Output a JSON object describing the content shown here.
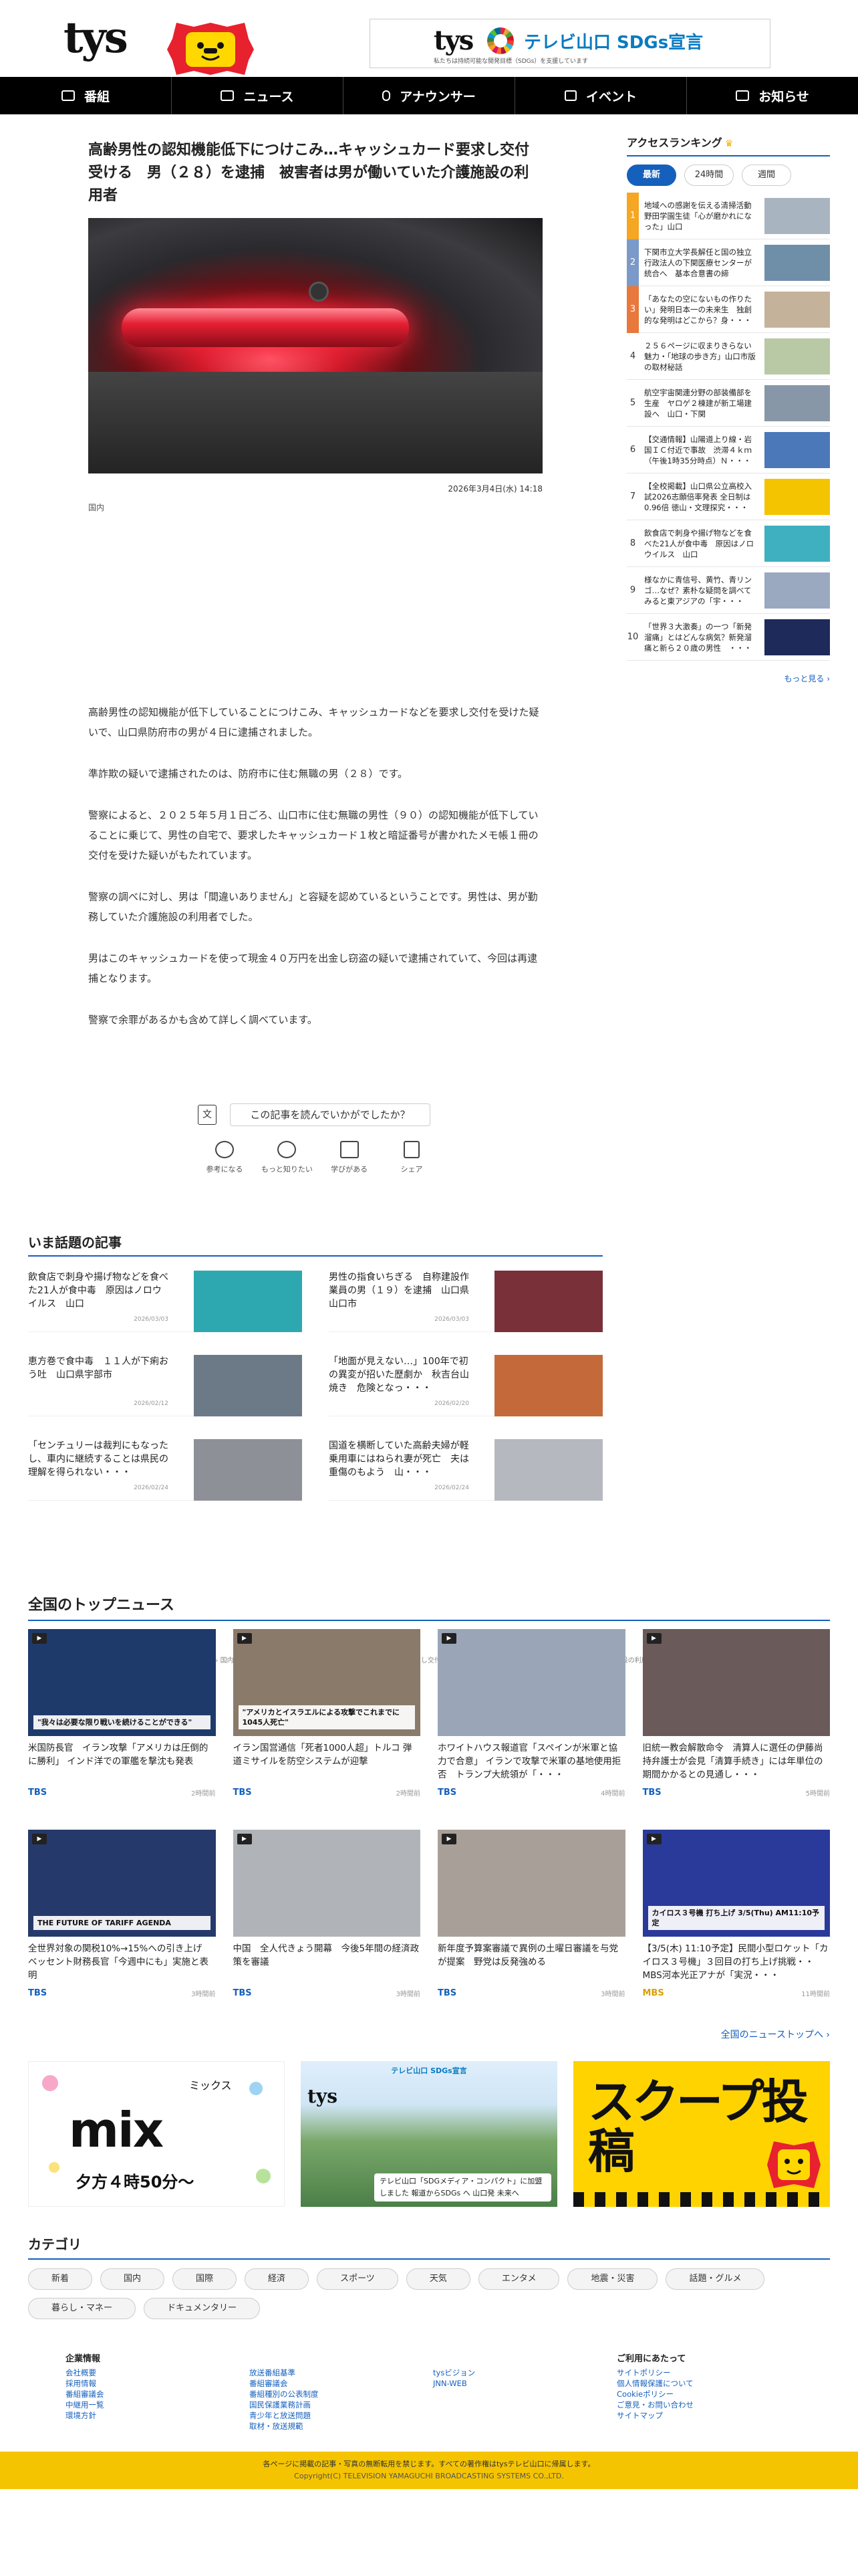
{
  "header": {
    "logo": "tys",
    "sdgs_logo": "tys",
    "sdgs_title": "テレビ山口 SDGs宣言",
    "sdgs_sub": "私たちは持続可能な開発目標（SDGs）を支援しています"
  },
  "nav": [
    {
      "label": "番組",
      "icon": "tv-icon"
    },
    {
      "label": "ニュース",
      "icon": "news-icon"
    },
    {
      "label": "アナウンサー",
      "icon": "microphone-icon"
    },
    {
      "label": "イベント",
      "icon": "megaphone-icon"
    },
    {
      "label": "お知らせ",
      "icon": "notice-icon"
    }
  ],
  "article": {
    "title": "高齢男性の認知機能低下につけこみ…キャッシュカード要求し交付受ける　男（２８）を逮捕　被害者は男が働いていた介護施設の利用者",
    "date": "2026年3月4日(水) 14:18",
    "category": "国内",
    "paragraphs": [
      "高齢男性の認知機能が低下していることにつけこみ、キャッシュカードなどを要求し交付を受けた疑いで、山口県防府市の男が４日に逮捕されました。",
      "準詐欺の疑いで逮捕されたのは、防府市に住む無職の男（２８）です。",
      "警察によると、２０２５年５月１日ごろ、山口市に住む無職の男性（９０）の認知機能が低下していることに乗じて、男性の自宅で、要求したキャッシュカード１枚と暗証番号が書かれたメモ帳１冊の交付を受けた疑いがもたれています。",
      "警察の調べに対し、男は「間違いありません」と容疑を認めているということです。男性は、男が勤務していた介護施設の利用者でした。",
      "男はこのキャッシュカードを使って現金４０万円を出金し窃盗の疑いで逮捕されていて、今回は再逮捕となります。",
      "警察で余罪があるかも含めて詳しく調べています。"
    ],
    "survey_box": "文",
    "survey_question": "この記事を読んでいかがでしたか？",
    "reactions": [
      "参考になる",
      "もっと知りたい",
      "学びがある",
      "シェア"
    ]
  },
  "ranking": {
    "title": "アクセスランキング",
    "tabs": [
      "最新",
      "24時間",
      "週間"
    ],
    "items": [
      {
        "num": "1",
        "text": "地域への感謝を伝える清掃活動 野田学園生徒「心が磨かれになった」山口"
      },
      {
        "num": "2",
        "text": "下関市立大学長解任と国の独立行政法人の下関医療センターが統合へ　基本合意書の締結・・・"
      },
      {
        "num": "3",
        "text": "「あなたの空にないもの作りたい」発明日本一の未来生　独創的な発明はどこから？身・・・"
      },
      {
        "num": "4",
        "text": "２５６ページに収まりきらない魅力・「地球の歩き方」山口市版の取材秘話"
      },
      {
        "num": "5",
        "text": "航空宇宙関連分野の部装備部を生産　ヤロゲ２棟建が新工場建設へ　山口・下関"
      },
      {
        "num": "6",
        "text": "【交通情報】山陽道上り線・岩国ＩＣ付近で事故　渋滞４ｋｍ（午後1時35分時点）Ｎ・・・"
      },
      {
        "num": "7",
        "text": "【全校掲載】山口県公立高校入試2026志願倍率発表 全日制は0.96倍 徳山・文理探究・・・"
      },
      {
        "num": "8",
        "text": "飲食店で刺身や揚げ物などを食べた21人が食中毒　原因はノロウイルス　山口"
      },
      {
        "num": "9",
        "text": "様なかに青信号、黄竹、青リンゴ…なぜ？素朴な疑問を調べてみると東アジアの「宇・・・"
      },
      {
        "num": "10",
        "text": "「世界３大激奏」の一つ「新発溜痛」とはどんな病気？新発溜痛と新ら２０歳の男性　・・・"
      }
    ],
    "more": "もっと見る ›"
  },
  "popular": {
    "title": "いま話題の記事",
    "items": [
      {
        "text": "飲食店で刺身や揚げ物などを食べた21人が食中毒　原因はノロウイルス　山口",
        "date": "2026/03/03"
      },
      {
        "text": "男性の指食いちぎる　自称建設作業員の男（１９）を逮捕　山口県山口市",
        "date": "2026/03/03"
      },
      {
        "text": "恵方巻で食中毒　１１人が下痢おう吐　山口県宇部市",
        "date": "2026/02/12"
      },
      {
        "text": "「地面が見えない…」100年で初の異変が招いた歴劇か　秋吉台山焼き　危険となっ・・・",
        "date": "2026/02/20"
      },
      {
        "text": "「センチュリーは裁判にもなったし、車内に継続することは県民の理解を得られない・・・",
        "date": "2026/02/24"
      },
      {
        "text": "国道を横断していた高齢夫婦が軽乗用車にはねられ妻が死亡　夫は重傷のもよう　山・・・",
        "date": "2026/02/24"
      }
    ]
  },
  "breadcrumb": "山口のニュース・天気・防災 | tys NEWS | ｔｙｓテレビ山口 › 国内 › 高齢男性の認知機能低下につけこみ…キャッシュカード要求し交付受ける　男（２８）を逮捕　被害者は男が働いていた介護施設の利用者",
  "top_news": {
    "title": "全国のトップニュース",
    "items": [
      {
        "text": "米国防長官　イラン攻撃「アメリカは圧倒的に勝利」 インド洋での軍艦を撃沈も発表",
        "source": "TBS",
        "time": "2時間前"
      },
      {
        "text": "イラン国営通信「死者1000人超」トルコ 弾道ミサイルを防空システムが迎撃",
        "source": "TBS",
        "time": "2時間前"
      },
      {
        "text": "ホワイトハウス報道官「スペインが米軍と協力で合意」 イランで攻撃で米軍の基地使用拒否　トランプ大統領が「・・・",
        "source": "TBS",
        "time": "4時間前"
      },
      {
        "text": "旧統一教会解散命令　清算人に選任の伊藤尚持弁護士が会見「清算手続き」には年単位の期間かかるとの見通し・・・",
        "source": "TBS",
        "time": "5時間前"
      },
      {
        "text": "全世界対象の関税10%→15%への引き上げ　ベッセント財務長官「今週中にも」実施と表明",
        "source": "TBS",
        "time": "3時間前"
      },
      {
        "text": "中国　全人代きょう開幕　今後5年間の経済政策を審議",
        "source": "TBS",
        "time": "3時間前"
      },
      {
        "text": "新年度予算案審議で異例の土曜日審議を与党が提案　野党は反発強める",
        "source": "TBS",
        "time": "3時間前"
      },
      {
        "text": "【3/5(木) 11:10予定】民間小型ロケット「カイロス３号機」３回目の打ち上げ挑戦・・MBS河本光正アナが「実況・・・",
        "source": "MBS",
        "time": "11時間前"
      }
    ],
    "thumb_text": [
      "\"我々は必要な限り戦いを続けることができる\"",
      "\"アメリカとイスラエルによる攻撃でこれまでに1045人死亡\"",
      "",
      "",
      "THE FUTURE OF TARIFF AGENDA",
      "",
      "",
      "カイロス３号機 打ち上げ 3/5(Thu) AM11:10予定"
    ],
    "all_link": "全国のニューストップへ ›"
  },
  "banners": {
    "mix_label": "ミックス",
    "mix_title": "mix",
    "mix_time": "夕方４時50分～",
    "sdgs_title": "テレビ山口 SDGs宣言",
    "sdgs_logo": "tys",
    "sdgs_cap": "テレビ山口「SDGメディア・コンパクト」に加盟しました 報道からSDGs へ 山口発 未来へ",
    "scoop_title": "スクープ投稿"
  },
  "categories": {
    "title": "カテゴリ",
    "items": [
      "新着",
      "国内",
      "国際",
      "経済",
      "スポーツ",
      "天気",
      "エンタメ",
      "地震・災害",
      "話題・グルメ",
      "暮らし・マネー",
      "ドキュメンタリー"
    ]
  },
  "footer_links": [
    {
      "head": "企業情報",
      "links": [
        "会社概要",
        "採用情報",
        "番組審議会",
        "中継用一覧",
        "環境方針"
      ]
    },
    {
      "head": "",
      "links": [
        "放送番組基準",
        "番組審議会",
        "番組種別の公表制度",
        "国民保護業務計画",
        "青少年と放送問題",
        "取材・放送規範"
      ]
    },
    {
      "head": "",
      "links": [
        "tysビジョン",
        "JNN-WEB"
      ]
    },
    {
      "head": "ご利用にあたって",
      "links": [
        "サイトポリシー",
        "個人情報保護について",
        "Cookieポリシー",
        "ご意見・お問い合わせ",
        "サイトマップ"
      ]
    }
  ],
  "footer": {
    "notice": "各ページに掲載の記事・写真の無断転用を禁じます。すべての著作権はtysテレビ山口に帰属します。",
    "copyright": "Copyright(C) TELEVISION YAMAGUCHI BROADCASTING SYSTEMS CO.,LTD."
  },
  "colors": {
    "accent": "#1560bd",
    "nav_bg": "#000000",
    "footer_bg": "#f5c400",
    "rank1": "#f5a623",
    "rank2": "#7b9ac9",
    "rank3": "#e8783b"
  }
}
